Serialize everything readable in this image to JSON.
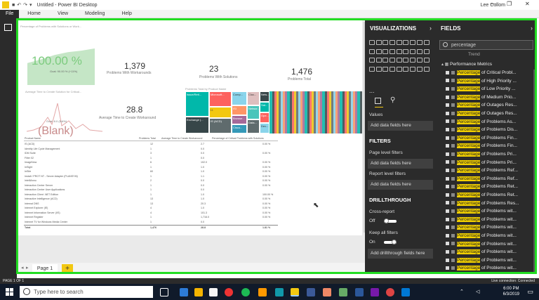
{
  "window": {
    "title": "Untitled - Power BI Desktop",
    "user": "Lee Cullom",
    "controls": [
      "—",
      "❐",
      "✕"
    ]
  },
  "ribbon": {
    "file": "File",
    "tabs": [
      "Home",
      "View",
      "Modeling",
      "Help"
    ]
  },
  "report": {
    "gauge_title": "Percentage of Problems with Solutions or Work...",
    "gauge_value": "100.00 %",
    "gauge_goal": "Goal: 90.00 % (+11%)",
    "cards": [
      {
        "value": "1,379",
        "label": "Problems With Workarounds"
      },
      {
        "value": "23",
        "label": "Problems With Solutions"
      },
      {
        "value": "1,476",
        "label": "Problems Total"
      },
      {
        "value": "28.8",
        "label": "Average Time to Create Workaround"
      }
    ],
    "avg_time_title": "Average Time to Create Solution for Critical...",
    "blank_value": "(Blank)",
    "blank_goal": "Goal: 8.0 (NA%)",
    "treemap_title": "Problems Total by Product Name",
    "treemap_labels": [
      "Issue/Reti...",
      "Microsoft...",
      "Comp...",
      "Cloc...",
      "Exchange (...",
      "I.I.",
      "ISI",
      "Browse...",
      "IS (ACD)",
      "Cisco...",
      "Networ...",
      "Data...",
      "Nets...",
      "Sat...",
      "Ope...",
      "Dev..."
    ],
    "table": {
      "headers": [
        "Product Name",
        "Problems Total",
        "Average Time to Create Workaround",
        "Percentage of Critical Problems with Solutions"
      ],
      "rows": [
        [
          "IS (ACD)",
          "12",
          "2.7",
          "0.00 %"
        ],
        [
          "Identity Life Cycle Management",
          "1",
          "0.0",
          ""
        ],
        [
          "IDM Suite",
          "3",
          "0.0",
          "0.00 %"
        ],
        [
          "Filter 02",
          "1",
          "0.0",
          ""
        ],
        [
          "ImageNow",
          "6",
          "102.0",
          "0.00 %"
        ],
        [
          "InSight",
          "1",
          "1.0",
          "0.00 %"
        ],
        [
          "InSite",
          "60",
          "1.0",
          "0.00 %"
        ],
        [
          "Install / PROT NT - Server Adapter (PLANSYM)",
          "1",
          "1.1",
          "0.00 %"
        ],
        [
          "IntelliAnnu",
          "2",
          "0.0",
          "0.00 %"
        ],
        [
          "Interaction Center Server",
          "1",
          "0.0",
          "0.00 %"
        ],
        [
          "Interaction Center User Applications",
          "1",
          "0.0",
          ""
        ],
        [
          "Interaction Client .NET Edition",
          "1",
          "1.0",
          "100.00 %"
        ],
        [
          "Interactive Intelligence (ACD)",
          "13",
          "1.0",
          "0.00 %"
        ],
        [
          "Internal DNS",
          "13",
          "20.3",
          "0.00 %"
        ],
        [
          "Internet Explorer (IE)",
          "4",
          "1.0",
          "0.00 %"
        ],
        [
          "Internet Information Server (IIS)",
          "4",
          "101.3",
          "0.00 %"
        ],
        [
          "Internet Register",
          "1",
          "1,716.0",
          "0.00 %"
        ],
        [
          "Internet TV for Windows Media Center",
          "1",
          "0.0",
          ""
        ]
      ],
      "total": [
        "Total",
        "1,476",
        "28.8",
        "1.81 %"
      ]
    },
    "page_tab": "Page 1",
    "add_page": "+"
  },
  "visualizations": {
    "title": "VISUALIZATIONS",
    "values_label": "Values",
    "values_placeholder": "Add data fields here",
    "filters_title": "FILTERS",
    "page_filters": "Page level filters",
    "page_filters_placeholder": "Add data fields here",
    "report_filters": "Report level filters",
    "report_filters_placeholder": "Add data fields here",
    "drill_title": "DRILLTHROUGH",
    "cross_report": "Cross-report",
    "cross_state": "Off",
    "keep_filters": "Keep all filters",
    "keep_state": "On",
    "drill_placeholder": "Add drillthrough fields here",
    "more": "..."
  },
  "fields": {
    "title": "FIELDS",
    "search_value": "percentage",
    "partial_item": "Trend",
    "group": "Performance Metrics",
    "highlight": "Percentage",
    "items": [
      " of Critical Probl...",
      " of High Priority ...",
      " of Low Priority ...",
      " of Medium Prio...",
      " of Outages Res...",
      " of Outages Res...",
      " of Problems As...",
      " of Problems Dis...",
      " of Problems Fin...",
      " of Problems Fin...",
      " of Problems Pri...",
      " of Problems Pri...",
      " of Problems Ref...",
      " of Problems Ref...",
      " of Problems Ret...",
      " of Problems Ret...",
      " of Problems Res...",
      " of Problems wit...",
      " of Problems wit...",
      " of Problems wit...",
      " of Problems wit...",
      " of Problems wit...",
      " of Problems wit...",
      " of Problems wit...",
      " of Problems wit..."
    ]
  },
  "status": {
    "page": "PAGE 1 OF 1",
    "connection": "Live connection: Connected"
  },
  "taskbar": {
    "search_placeholder": "Type here to search",
    "time": "6:00 PM",
    "date": "6/3/2019"
  },
  "colors": {
    "accent": "#F2C811",
    "highlight_border": "#22DD22",
    "pane_bg": "#2B2B2B"
  }
}
